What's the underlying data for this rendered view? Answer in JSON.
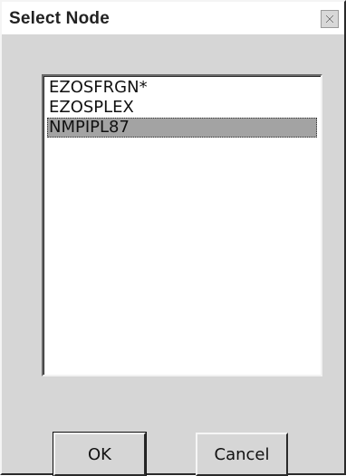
{
  "window": {
    "title": "Select Node",
    "close_icon": "close-icon"
  },
  "list": {
    "items": [
      "EZOSFRGN*",
      "EZOSPLEX",
      "NMPIPL87"
    ],
    "selected_item": "NMPIPL87"
  },
  "buttons": {
    "ok_label": "OK",
    "cancel_label": "Cancel"
  },
  "colors": {
    "selection": "#a3a3a3",
    "face": "#d6d6d6"
  }
}
